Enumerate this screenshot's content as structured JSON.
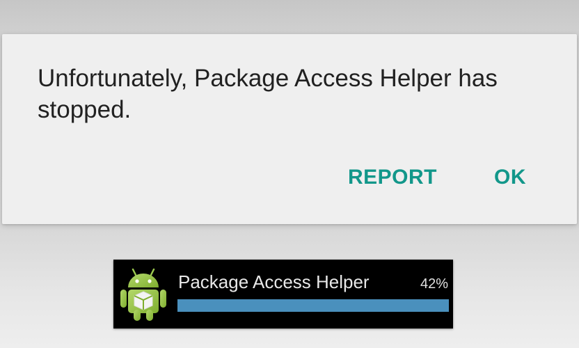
{
  "dialog": {
    "message": "Unfortunately, Package Access Helper has stopped.",
    "report_label": "REPORT",
    "ok_label": "OK",
    "accent_color": "#12978a"
  },
  "notification": {
    "title": "Package Access Helper",
    "percent_label": "42%",
    "progress": 1.0,
    "icon": "android-robot-with-package-icon",
    "progress_color": "#4a90bd"
  }
}
